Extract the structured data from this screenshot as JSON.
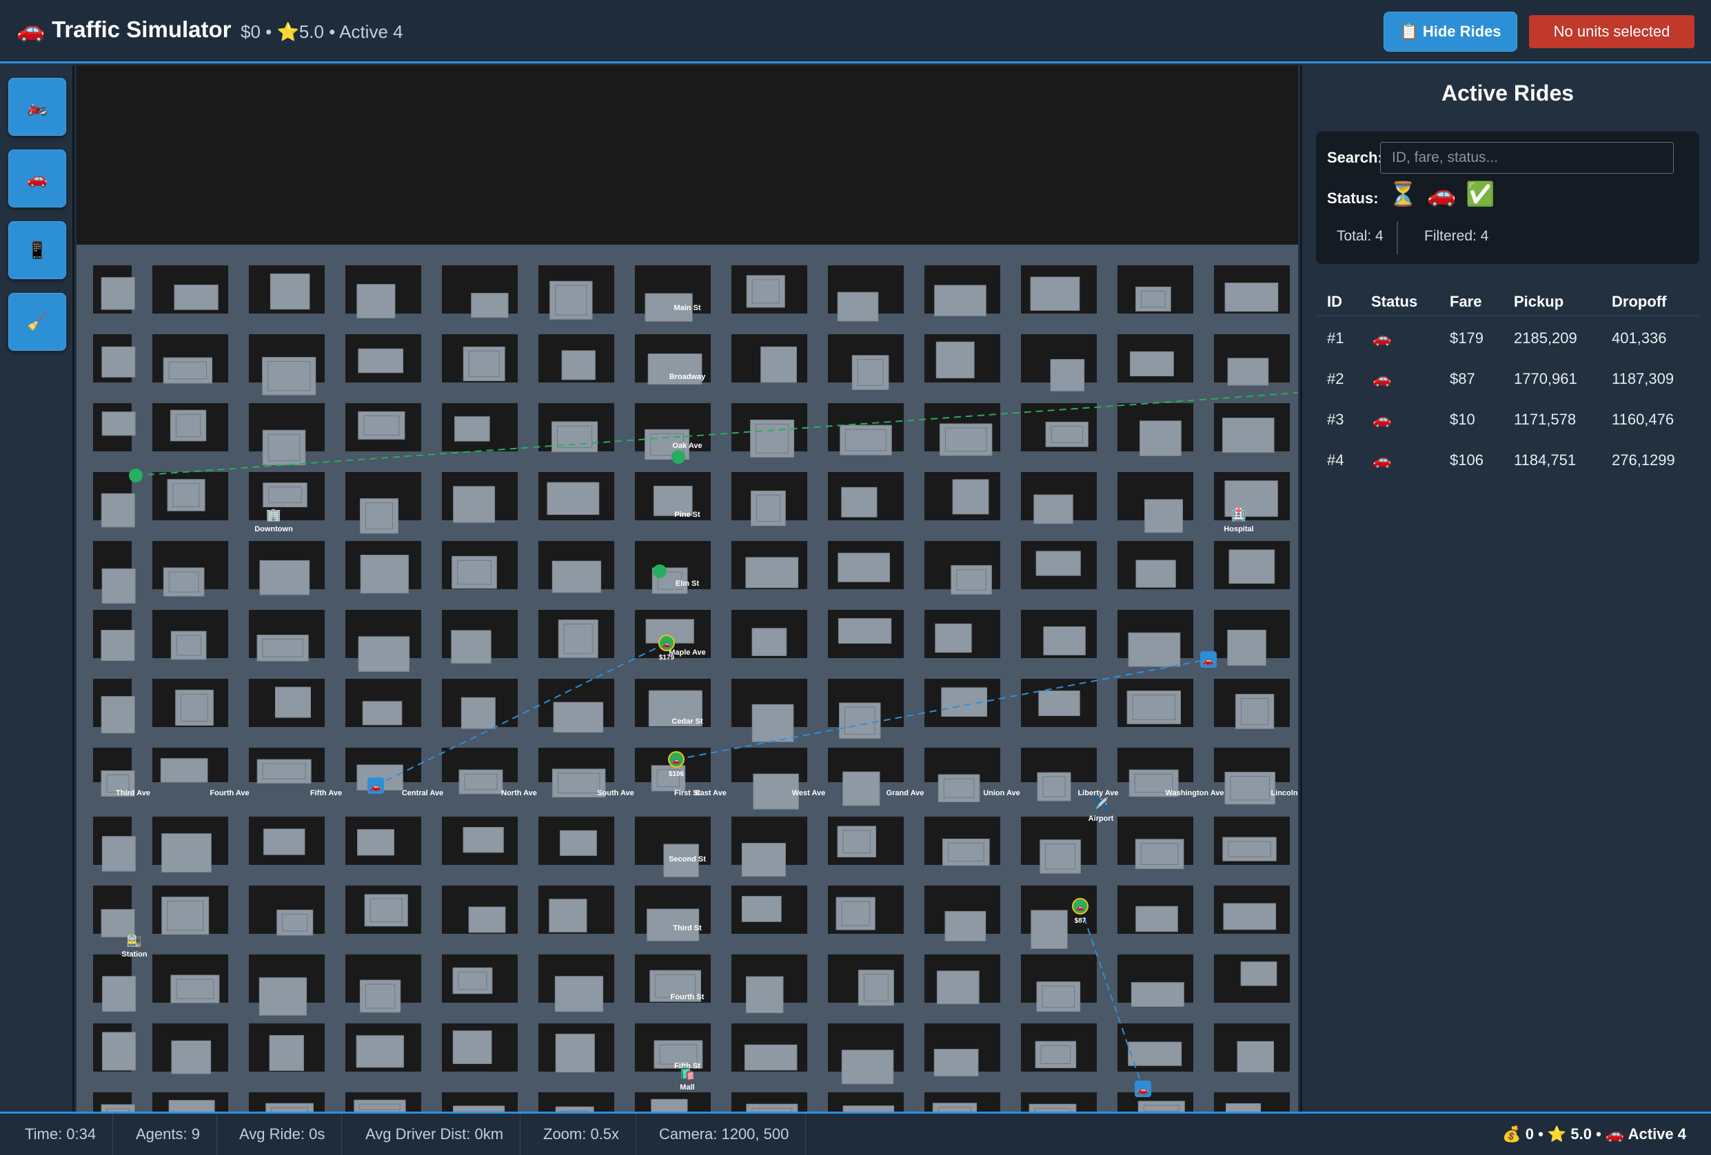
{
  "header": {
    "title": "Traffic Simulator",
    "title_icon": "🚗",
    "stats": "$0 • ⭐5.0 • Active 4",
    "hide_rides_label": "Hide Rides",
    "hide_rides_icon": "📋",
    "selection_label": "No units selected"
  },
  "toolbar": {
    "tools": [
      {
        "name": "motorcycle-tool",
        "icon": "🏍️"
      },
      {
        "name": "car-tool",
        "icon": "🚗"
      },
      {
        "name": "phone-tool",
        "icon": "📱"
      },
      {
        "name": "broom-tool",
        "icon": "🧹"
      }
    ]
  },
  "map": {
    "horizontal_streets": [
      "Main St",
      "Broadway",
      "Oak Ave",
      "Pine St",
      "Elm St",
      "Maple Ave",
      "Cedar St",
      "Second St",
      "Third St",
      "Fourth St",
      "Fifth St"
    ],
    "vertical_streets": [
      "Third Ave",
      "Fourth Ave",
      "Fifth Ave",
      "Central Ave",
      "North Ave",
      "South Ave",
      "First St",
      "East Ave",
      "West Ave",
      "Grand Ave",
      "Union Ave",
      "Liberty Ave",
      "Washington Ave",
      "Lincoln"
    ],
    "landmarks": [
      {
        "label": "Downtown",
        "icon": "🏢"
      },
      {
        "label": "Hospital",
        "icon": "🏥"
      },
      {
        "label": "Airport",
        "icon": "✈️"
      },
      {
        "label": "Station",
        "icon": "🚉"
      },
      {
        "label": "Mall",
        "icon": "🛍️"
      }
    ],
    "fare_markers": [
      "$179",
      "$106",
      "$87"
    ],
    "colors": {
      "road": "#4a5868",
      "building": "#8f99a3",
      "route_blue": "#2f8fd8",
      "route_green": "#27ae60",
      "car_badge": "#2d8fd6"
    }
  },
  "rides_panel": {
    "title": "Active Rides",
    "search_label": "Search:",
    "search_placeholder": "ID, fare, status...",
    "status_label": "Status:",
    "status_filters": [
      {
        "name": "waiting",
        "icon": "⏳"
      },
      {
        "name": "in-progress",
        "icon": "🚗"
      },
      {
        "name": "completed",
        "icon": "✅"
      }
    ],
    "total": "Total: 4",
    "filtered": "Filtered: 4",
    "columns": [
      "ID",
      "Status",
      "Fare",
      "Pickup",
      "Dropoff"
    ],
    "rows": [
      {
        "id": "#1",
        "status": "🚗",
        "fare": "$179",
        "pickup": "2185,209",
        "dropoff": "401,336"
      },
      {
        "id": "#2",
        "status": "🚗",
        "fare": "$87",
        "pickup": "1770,961",
        "dropoff": "1187,309"
      },
      {
        "id": "#3",
        "status": "🚗",
        "fare": "$10",
        "pickup": "1171,578",
        "dropoff": "1160,476"
      },
      {
        "id": "#4",
        "status": "🚗",
        "fare": "$106",
        "pickup": "1184,751",
        "dropoff": "276,1299"
      }
    ]
  },
  "statusbar": {
    "time": "Time: 0:34",
    "agents": "Agents: 9",
    "avg_ride": "Avg Ride: 0s",
    "avg_driver_dist": "Avg Driver Dist: 0km",
    "zoom": "Zoom: 0.5x",
    "camera": "Camera: 1200, 500",
    "summary": "💰 0 • ⭐ 5.0 • 🚗 Active 4"
  }
}
